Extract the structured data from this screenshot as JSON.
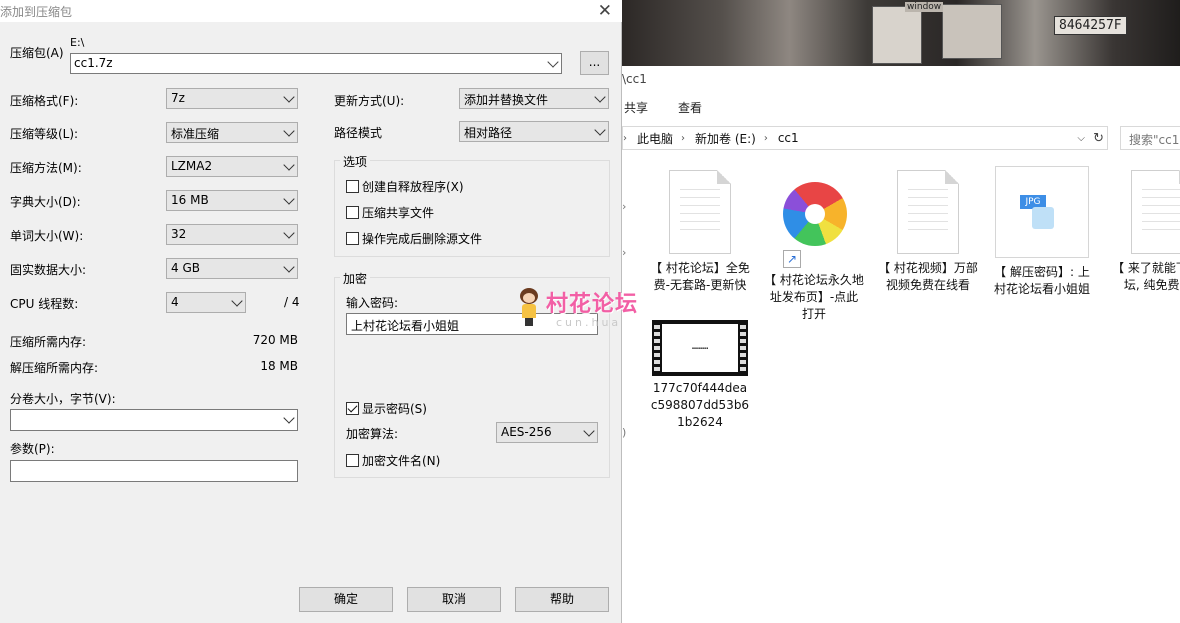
{
  "explorer": {
    "title": "\\cc1",
    "ribbon": {
      "share": "共享",
      "view": "查看"
    },
    "breadcrumb": [
      "此电脑",
      "新加卷 (E:)",
      "cc1"
    ],
    "search_placeholder": "搜索\"cc1\"",
    "photo_tag": "8464257F",
    "photo_sign": "window",
    "files": [
      {
        "name": "【 村花论坛】全免费-无套路-更新快",
        "icon": "text-file-icon"
      },
      {
        "name": "【 村花论坛永久地址发布页】-点此打开",
        "icon": "pinwheel-shortcut-icon"
      },
      {
        "name": "【 村花视频】万部视频免费在线看",
        "icon": "text-file-icon"
      },
      {
        "name": "【 解压密码】: 上村花论坛看小姐姐",
        "icon": "jpg-file-icon"
      },
      {
        "name": "【 来了就能下的论坛, 纯免费! 】",
        "icon": "text-file-icon"
      },
      {
        "name": "177c70f444deac598807dd53b61b2624",
        "icon": "video-file-icon"
      }
    ],
    "jpg_badge": "JPG"
  },
  "dialog": {
    "title": "添加到压缩包",
    "archive_label": "压缩包(A)",
    "archive_path": "E:\\",
    "archive_name": "cc1.7z",
    "browse_label": "...",
    "format_label": "压缩格式(F):",
    "format_value": "7z",
    "level_label": "压缩等级(L):",
    "level_value": "标准压缩",
    "method_label": "压缩方法(M):",
    "method_value": "LZMA2",
    "dict_label": "字典大小(D):",
    "dict_value": "16 MB",
    "word_label": "单词大小(W):",
    "word_value": "32",
    "solid_label": "固实数据大小:",
    "solid_value": "4 GB",
    "cpu_label": "CPU 线程数:",
    "cpu_value": "4",
    "cpu_total": "/ 4",
    "mem_comp_label": "压缩所需内存:",
    "mem_comp_value": "720 MB",
    "mem_decomp_label": "解压缩所需内存:",
    "mem_decomp_value": "18 MB",
    "split_label": "分卷大小，字节(V):",
    "split_value": "",
    "params_label": "参数(P):",
    "params_value": "",
    "update_label": "更新方式(U):",
    "update_value": "添加并替换文件",
    "path_label": "路径模式",
    "path_value": "相对路径",
    "options_title": "选项",
    "opt_sfx": "创建自释放程序(X)",
    "opt_shared": "压缩共享文件",
    "opt_delete": "操作完成后删除源文件",
    "encrypt_title": "加密",
    "password_label": "输入密码:",
    "password_value": "上村花论坛看小姐姐",
    "show_password": "显示密码(S)",
    "enc_method_label": "加密算法:",
    "enc_method_value": "AES-256",
    "encrypt_names": "加密文件名(N)",
    "ok": "确定",
    "cancel": "取消",
    "help": "帮助"
  },
  "watermark": {
    "text": "村花论坛",
    "sub": "cun.hua"
  }
}
